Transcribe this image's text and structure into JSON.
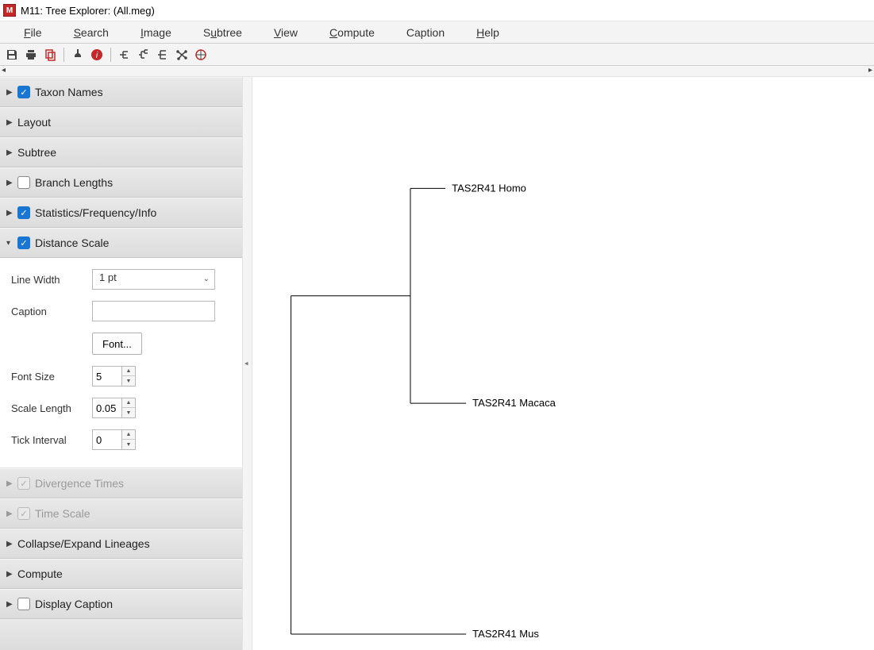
{
  "window": {
    "title": "M11: Tree Explorer: (All.meg)"
  },
  "menus": {
    "file": "File",
    "search": "Search",
    "image": "Image",
    "subtree": "Subtree",
    "view": "View",
    "compute": "Compute",
    "caption": "Caption",
    "help": "Help"
  },
  "panels": {
    "taxon_names": "Taxon Names",
    "layout": "Layout",
    "subtree": "Subtree",
    "branch_lengths": "Branch Lengths",
    "stats": "Statistics/Frequency/Info",
    "distance_scale": "Distance Scale",
    "divergence_times": "Divergence Times",
    "time_scale": "Time Scale",
    "collapse": "Collapse/Expand Lineages",
    "compute": "Compute",
    "display_caption": "Display Caption"
  },
  "distance_scale_form": {
    "line_width_label": "Line Width",
    "line_width_value": "1 pt",
    "caption_label": "Caption",
    "caption_value": "",
    "font_button": "Font...",
    "font_size_label": "Font Size",
    "font_size_value": "5",
    "scale_length_label": "Scale Length",
    "scale_length_value": "0.05",
    "tick_interval_label": "Tick Interval",
    "tick_interval_value": "0"
  },
  "tree": {
    "taxa": [
      "TAS2R41 Homo",
      "TAS2R41 Macaca",
      "TAS2R41 Mus"
    ]
  }
}
